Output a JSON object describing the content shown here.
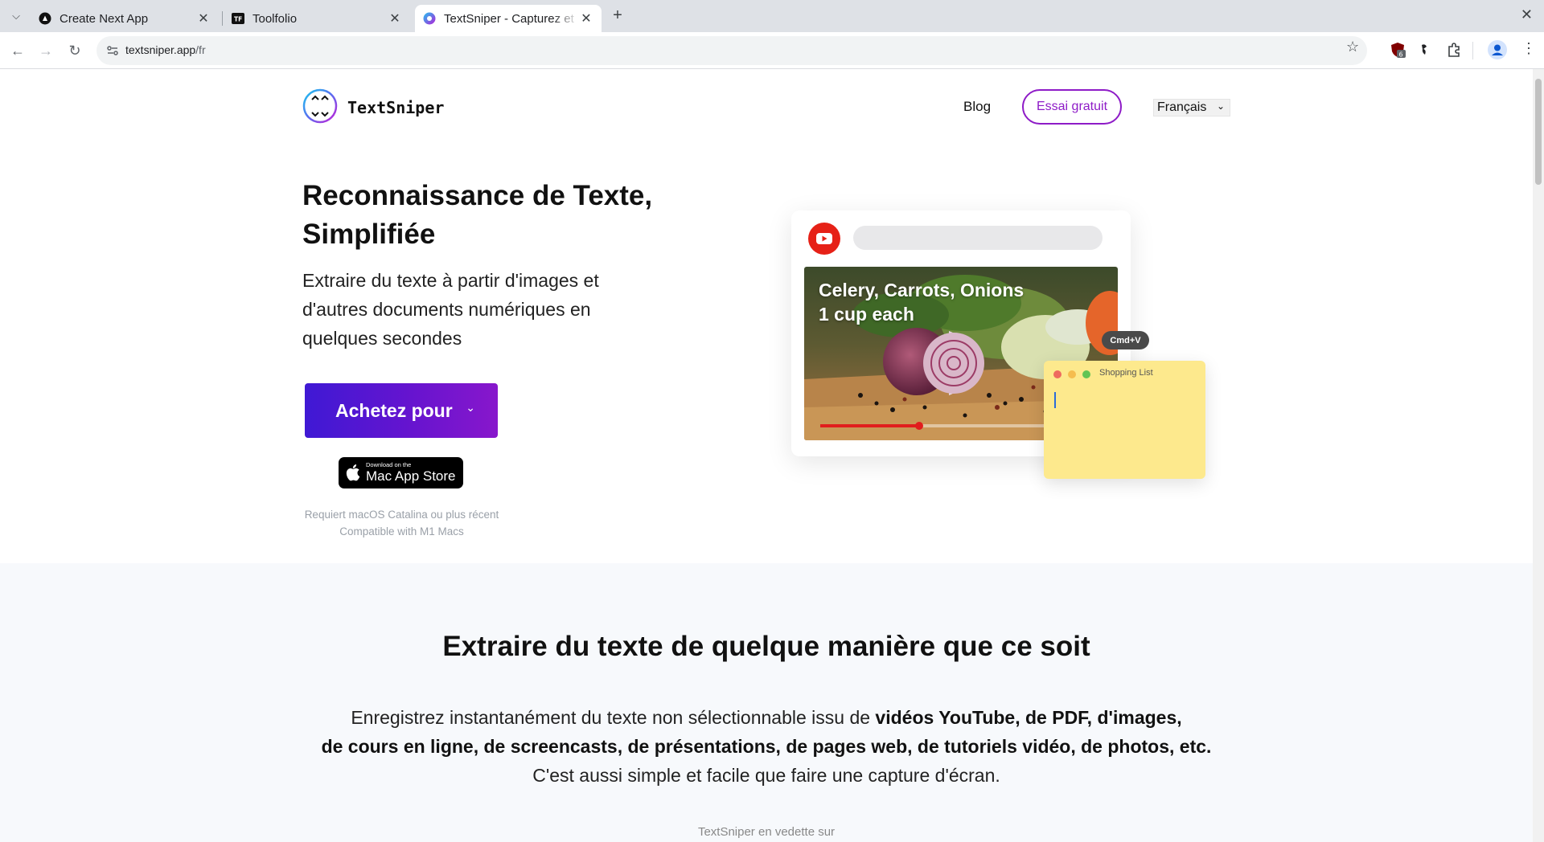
{
  "browser": {
    "tabs": [
      {
        "title": "Create Next App",
        "active": false
      },
      {
        "title": "Toolfolio",
        "active": false
      },
      {
        "title": "TextSniper - Capturez et",
        "active": true
      }
    ],
    "url_host": "textsniper.app",
    "url_path": "/fr",
    "extension_badge": "6"
  },
  "header": {
    "brand": "TextSniper",
    "nav_blog": "Blog",
    "nav_trial": "Essai gratuit",
    "language": "Français"
  },
  "hero": {
    "title": "Reconnaissance de Texte, Simplifiée",
    "subtitle": "Extraire du texte à partir d'images et d'autres documents numériques en quelques secondes",
    "buy_label": "Achetez pour",
    "appstore_small": "Download on the",
    "appstore_big": "Mac App Store",
    "requirement_1": "Requiert macOS Catalina ou plus récent",
    "requirement_2": "Compatible with M1 Macs"
  },
  "illustration": {
    "caption_line1": "Celery, Carrots, Onions",
    "caption_line2": "1 cup each",
    "video_progress": 0.35,
    "shortcut": "Cmd+V",
    "note_title": "Shopping List"
  },
  "section2": {
    "title": "Extraire du texte de quelque manière que ce soit",
    "text_plain1": "Enregistrez instantanément du texte non sélectionnable issu de ",
    "text_bold1": "vidéos YouTube, de PDF, d'images,",
    "text_bold2": "de cours en ligne, de screencasts, de présentations, de pages web, de tutoriels vidéo, de photos, etc.",
    "text_plain2": "C'est aussi simple et facile que faire une capture d'écran.",
    "featured": "TextSniper en vedette sur"
  },
  "colors": {
    "accent_purple": "#8e1bc7",
    "button_start": "#3f19d4",
    "button_end": "#8817cc",
    "note_yellow": "#fde98d",
    "youtube_red": "#e11d1d"
  }
}
